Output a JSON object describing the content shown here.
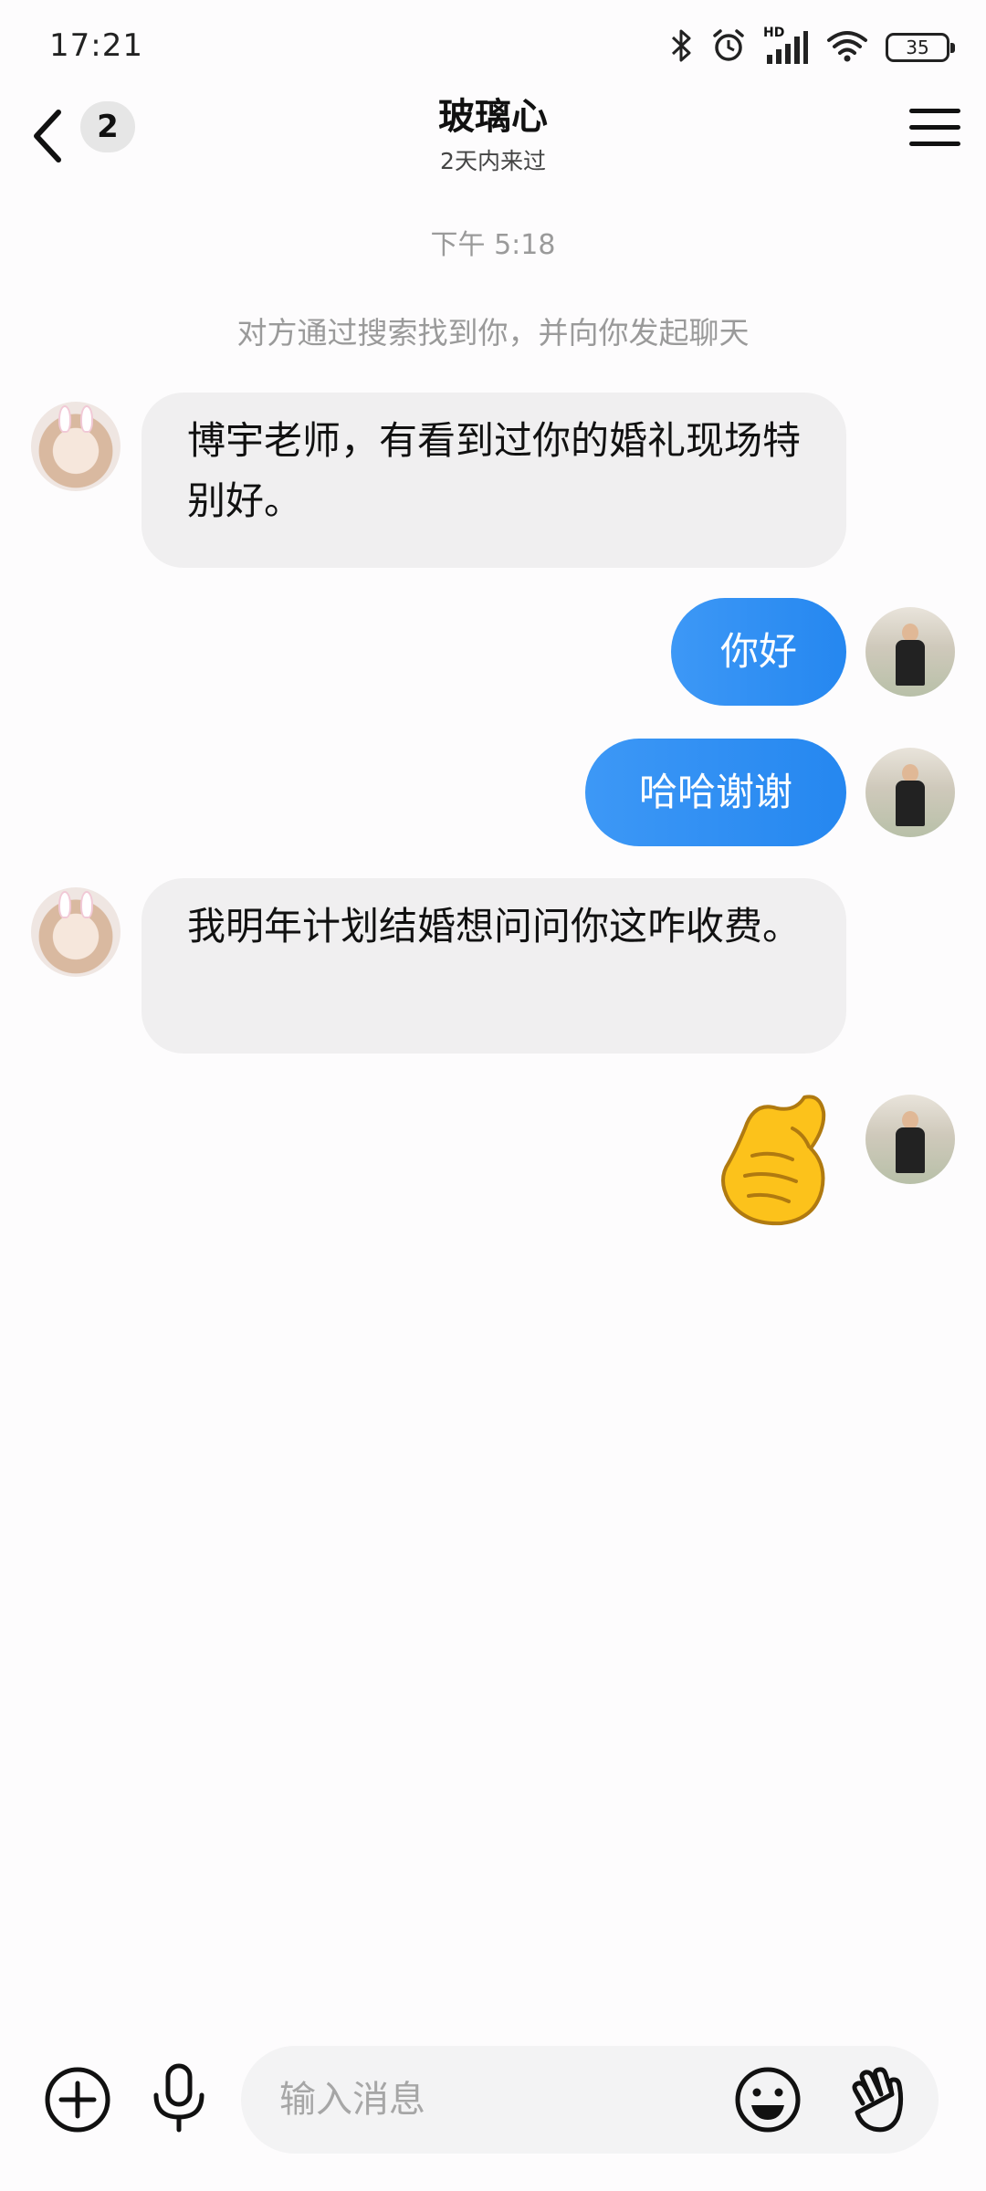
{
  "status_bar": {
    "time": "17:21",
    "icons": [
      "bluetooth-icon",
      "alarm-icon",
      "signal-icon",
      "wifi-icon",
      "battery-icon"
    ],
    "signal_label": "HD",
    "battery_level": "35"
  },
  "header": {
    "unread_count": "2",
    "contact_name": "玻璃心",
    "contact_status": "2天内来过"
  },
  "chat": {
    "timestamp": "下午 5:18",
    "system_notice": "对方通过搜索找到你，并向你发起聊天",
    "messages": [
      {
        "from": "other",
        "text": "博宇老师，有看到过你的婚礼现场特别好。"
      },
      {
        "from": "me",
        "text": "你好"
      },
      {
        "from": "me",
        "text": "哈哈谢谢"
      },
      {
        "from": "other",
        "text": "我明年计划结婚想问问你这咋收费。"
      },
      {
        "from": "me",
        "sticker": "pinched-fingers-emoji"
      }
    ]
  },
  "input_bar": {
    "placeholder": "输入消息",
    "value": "",
    "icons": [
      "add-icon",
      "microphone-icon",
      "emoji-icon",
      "wave-hand-icon"
    ]
  },
  "colors": {
    "outgoing_bubble": "#2a8cf2",
    "incoming_bubble": "#f0eff0",
    "muted_text": "#9a9a9a"
  }
}
